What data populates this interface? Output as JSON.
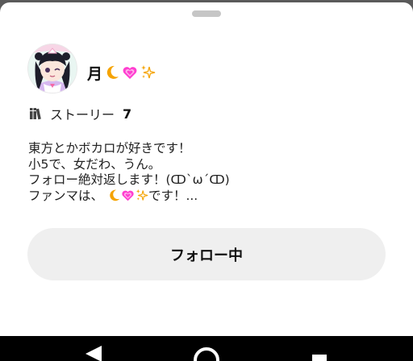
{
  "profile": {
    "name": "月"
  },
  "stats": {
    "label": "ストーリー",
    "count": "7"
  },
  "bio": {
    "line1": "東方とかボカロが好きです！",
    "line2": "小5で、女だわ、うん。",
    "line3": "フォロー絶対返します！(ↀ`ω´ↀ)",
    "line4_prefix": "ファンマは、",
    "line4_suffix": "です！..."
  },
  "actions": {
    "follow_label": "フォロー中"
  },
  "icons": {
    "name_emojis": [
      "crescent-moon",
      "sparkling-heart",
      "sparkles"
    ],
    "stats_icon": "books-icon",
    "navbar": [
      "back-icon",
      "home-icon",
      "recents-icon"
    ]
  },
  "colors": {
    "button_bg": "#efefef",
    "sheet_bg": "#ffffff",
    "scrim": "#5a5a5a",
    "navbar_bg": "#000000",
    "heart": "#ff3fd0",
    "moon": "#f5a300"
  }
}
